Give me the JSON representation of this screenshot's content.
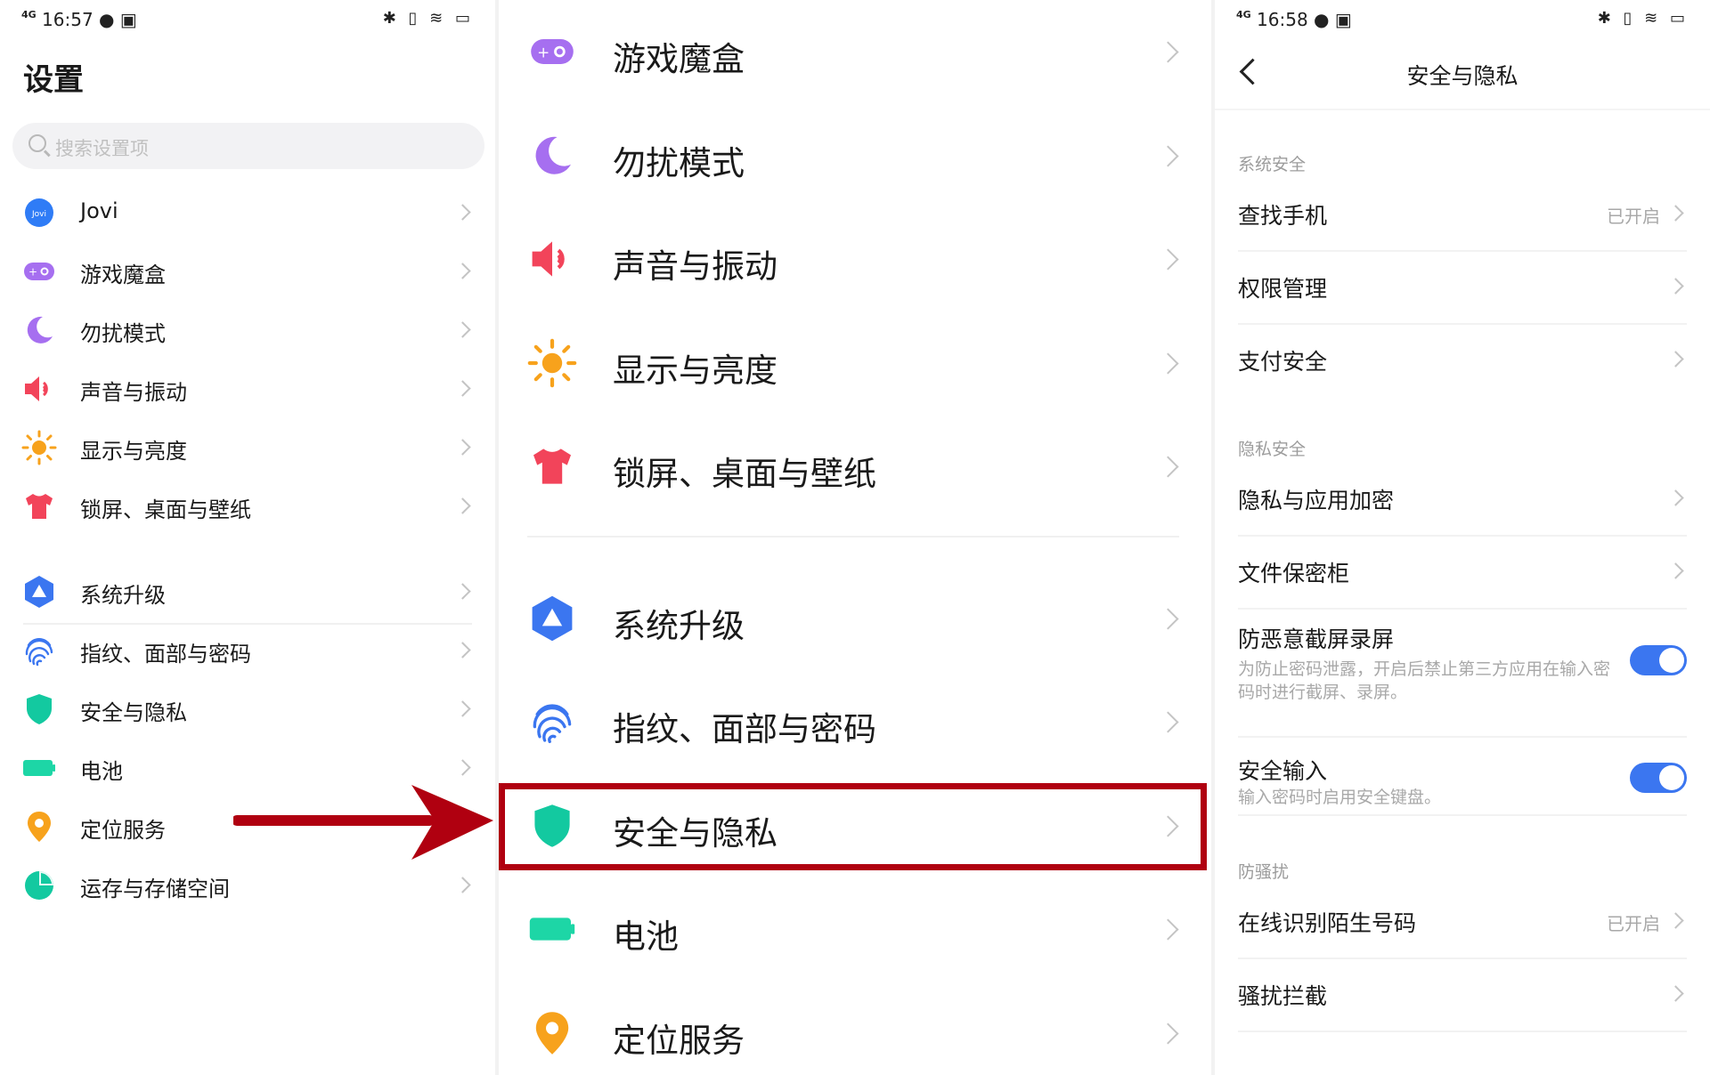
{
  "left_panel": {
    "status": {
      "network": "4G",
      "time": "16:57",
      "icons": "✱ ▯ ≋ ▭"
    },
    "title": "设置",
    "search_placeholder": "搜索设置项",
    "items": [
      {
        "label": "Jovi",
        "icon": "jovi-icon"
      },
      {
        "label": "游戏魔盒",
        "icon": "gamepad-icon"
      },
      {
        "label": "勿扰模式",
        "icon": "moon-icon"
      },
      {
        "label": "声音与振动",
        "icon": "speaker-icon"
      },
      {
        "label": "显示与亮度",
        "icon": "sun-icon"
      },
      {
        "label": "锁屏、桌面与壁纸",
        "icon": "shirt-icon"
      },
      {
        "label": "系统升级",
        "icon": "upgrade-icon"
      },
      {
        "label": "指纹、面部与密码",
        "icon": "fingerprint-icon"
      },
      {
        "label": "安全与隐私",
        "icon": "shield-icon"
      },
      {
        "label": "电池",
        "icon": "battery-icon"
      },
      {
        "label": "定位服务",
        "icon": "location-pin-icon"
      },
      {
        "label": "运存与存储空间",
        "icon": "storage-pie-icon"
      }
    ]
  },
  "middle_panel": {
    "items": [
      {
        "label": "游戏魔盒",
        "icon": "gamepad-icon"
      },
      {
        "label": "勿扰模式",
        "icon": "moon-icon"
      },
      {
        "label": "声音与振动",
        "icon": "speaker-icon"
      },
      {
        "label": "显示与亮度",
        "icon": "sun-icon"
      },
      {
        "label": "锁屏、桌面与壁纸",
        "icon": "shirt-icon"
      },
      {
        "label": "系统升级",
        "icon": "upgrade-icon"
      },
      {
        "label": "指纹、面部与密码",
        "icon": "fingerprint-icon"
      },
      {
        "label": "安全与隐私",
        "icon": "shield-icon"
      },
      {
        "label": "电池",
        "icon": "battery-icon"
      },
      {
        "label": "定位服务",
        "icon": "location-pin-icon"
      }
    ],
    "highlight_color": "#b00010"
  },
  "right_panel": {
    "status": {
      "network": "4G",
      "time": "16:58",
      "icons": "✱ ▯ ≋ ▭"
    },
    "title": "安全与隐私",
    "section_system": "系统安全",
    "find_phone": {
      "label": "查找手机",
      "value": "已开启"
    },
    "permissions": {
      "label": "权限管理"
    },
    "payment": {
      "label": "支付安全"
    },
    "section_privacy": "隐私安全",
    "app_encrypt": {
      "label": "隐私与应用加密"
    },
    "file_safe": {
      "label": "文件保密柜"
    },
    "anti_screenshot": {
      "label": "防恶意截屏录屏",
      "desc": "为防止密码泄露，开启后禁止第三方应用在输入密码时进行截屏、录屏。",
      "enabled": true
    },
    "secure_input": {
      "label": "安全输入",
      "desc": "输入密码时启用安全键盘。",
      "enabled": true
    },
    "section_harass": "防骚扰",
    "online_id": {
      "label": "在线识别陌生号码",
      "value": "已开启"
    },
    "harass_block": {
      "label": "骚扰拦截"
    },
    "accent_color": "#3b76f0"
  }
}
